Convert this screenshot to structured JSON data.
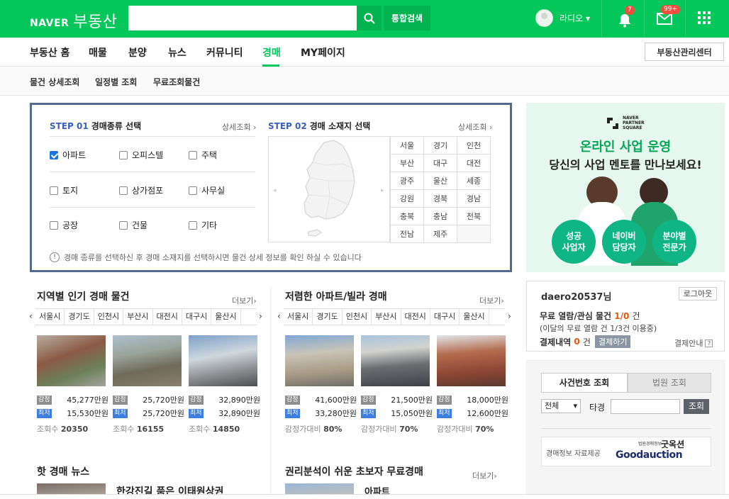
{
  "header": {
    "logo_naver": "NAVER",
    "logo_service": "부동산",
    "search_placeholder": "",
    "search_button": "통합검색",
    "username": "라디오",
    "notif_count": "7",
    "mail_count": "99+"
  },
  "nav": {
    "items": [
      "부동산 홈",
      "매물",
      "분양",
      "뉴스",
      "커뮤니티",
      "경매",
      "MY페이지"
    ],
    "active": "경매",
    "manager_button": "부동산관리센터"
  },
  "subnav": {
    "items": [
      "물건 상세조회",
      "일정별 조회",
      "무료조회물건"
    ]
  },
  "step1": {
    "num": "STEP 01",
    "title": "경매종류 선택",
    "more": "상세조회",
    "options": [
      {
        "label": "아파트",
        "checked": true
      },
      {
        "label": "오피스텔",
        "checked": false
      },
      {
        "label": "주택",
        "checked": false
      },
      {
        "label": "토지",
        "checked": false
      },
      {
        "label": "상가점포",
        "checked": false
      },
      {
        "label": "사무실",
        "checked": false
      },
      {
        "label": "공장",
        "checked": false
      },
      {
        "label": "건물",
        "checked": false
      },
      {
        "label": "기타",
        "checked": false
      }
    ]
  },
  "step2": {
    "num": "STEP 02",
    "title": "경매 소재지 선택",
    "more": "상세조회",
    "regions": [
      [
        "서울",
        "경기",
        "인천"
      ],
      [
        "부산",
        "대구",
        "대전"
      ],
      [
        "광주",
        "울산",
        "세종"
      ],
      [
        "강원",
        "경북",
        "경남"
      ],
      [
        "충북",
        "충남",
        "전북"
      ],
      [
        "전남",
        "제주",
        ""
      ]
    ]
  },
  "notice": "경매 종류를 선택하신 후 경매 소재지를 선택하시면 물건 상세 정보를 확인 하실 수 있습니다",
  "popular": {
    "title": "지역별 인기 경매 물건",
    "more": "더보기",
    "tabs": [
      "서울시",
      "경기도",
      "인천시",
      "부산시",
      "대전시",
      "대구시",
      "울산시"
    ],
    "tag_appraisal": "감정",
    "tag_min": "최저",
    "count_label": "조회수",
    "items": [
      {
        "appraisal": "45,277만원",
        "min": "15,530만원",
        "views": "20350"
      },
      {
        "appraisal": "25,720만원",
        "min": "25,720만원",
        "views": "16155"
      },
      {
        "appraisal": "32,890만원",
        "min": "32,890만원",
        "views": "14850"
      }
    ]
  },
  "cheap": {
    "title": "저렴한 아파트/빌라 경매",
    "more": "더보기",
    "tabs": [
      "서울시",
      "경기도",
      "인천시",
      "부산시",
      "대전시",
      "대구시",
      "울산시"
    ],
    "tag_appraisal": "감정",
    "tag_min": "최저",
    "ratio_label": "감정가대비",
    "items": [
      {
        "appraisal": "41,600만원",
        "min": "33,280만원",
        "ratio": "80%"
      },
      {
        "appraisal": "21,500만원",
        "min": "15,050만원",
        "ratio": "70%"
      },
      {
        "appraisal": "18,000만원",
        "min": "12,600만원",
        "ratio": "70%"
      }
    ]
  },
  "hotnews": {
    "title": "핫 경매 뉴스",
    "headline": "한강진길 품은 이태원상권"
  },
  "beginner": {
    "title": "권리분석이 쉬운 초보자 무료경매",
    "more": "더보기",
    "first_type": "아파트"
  },
  "ad": {
    "brand_line1": "NAVER",
    "brand_line2": "PARTNER",
    "brand_line3": "SQUARE",
    "headline": "온라인 사업 운영",
    "subhead": "당신의 사업 멘토를 만나보세요!",
    "circles": [
      "성공\n사업자",
      "네이버\n담당자",
      "분야별\n전문가"
    ]
  },
  "login": {
    "user": "daero20537님",
    "logout": "로그아웃",
    "free_label": "무료 열람/관심 물건",
    "free_value": "1/0",
    "free_unit": "건",
    "monthly": "(이달의 무료 열람 건 1/3건 이용중)",
    "payment_label": "결제내역",
    "payment_value": "0",
    "payment_unit": "건",
    "pay_button": "결제하기",
    "pay_guide": "결제안내"
  },
  "case": {
    "tab_case": "사건번호 조회",
    "tab_court": "법원 조회",
    "select_value": "전체",
    "prefix": "타경",
    "search_button": "조회",
    "provider_label": "경매정보 자료제공",
    "provider_small": "법원경매정보",
    "provider_name": "굿옥션",
    "provider_en": "Goodauction"
  }
}
